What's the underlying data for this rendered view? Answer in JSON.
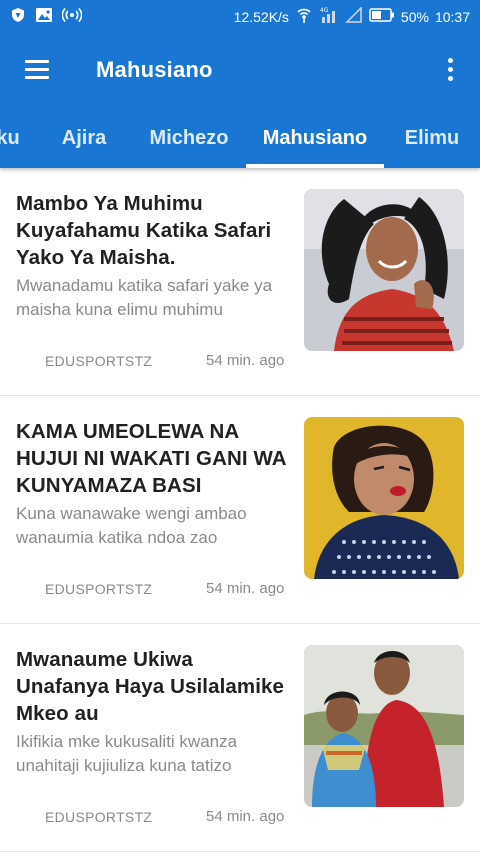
{
  "status_bar": {
    "net_speed": "12.52K/s",
    "battery": "50%",
    "time": "10:37",
    "left_icons": [
      "vpn-shield-icon",
      "image-icon",
      "hotspot-icon"
    ],
    "right_icons": [
      "wifi-icon",
      "signal-4g-icon",
      "signal-icon",
      "battery-icon"
    ]
  },
  "app_bar": {
    "title": "Mahusiano",
    "menu_icon": "hamburger-menu-icon",
    "more_icon": "more-vertical-icon"
  },
  "tabs": [
    {
      "label": "ku",
      "active": false
    },
    {
      "label": "Ajira",
      "active": false
    },
    {
      "label": "Michezo",
      "active": false
    },
    {
      "label": "Mahusiano",
      "active": true
    },
    {
      "label": "Elimu",
      "active": false
    }
  ],
  "articles": [
    {
      "title": "Mambo Ya Muhimu Kuyafahamu Katika Safari Yako Ya Maisha.",
      "excerpt": "Mwanadamu katika safari yake ya maisha kuna elimu muhimu",
      "source": "EDUSPORTSTZ",
      "time": "54 min. ago"
    },
    {
      "title": "KAMA UMEOLEWA NA HUJUI NI WAKATI GANI WA KUNYAMAZA BASI",
      "excerpt": "Kuna wanawake wengi ambao wanaumia katika ndoa zao",
      "source": "EDUSPORTSTZ",
      "time": "54 min. ago"
    },
    {
      "title": "Mwanaume Ukiwa Unafanya Haya Usilalamike Mkeo au",
      "excerpt": "Ikifikia mke kukusaliti kwanza unahitaji kujiuliza kuna tatizo",
      "source": "EDUSPORTSTZ",
      "time": "54 min. ago"
    }
  ],
  "colors": {
    "primary": "#1976d2",
    "title_text": "#212121",
    "secondary_text": "#8a8a8a"
  }
}
